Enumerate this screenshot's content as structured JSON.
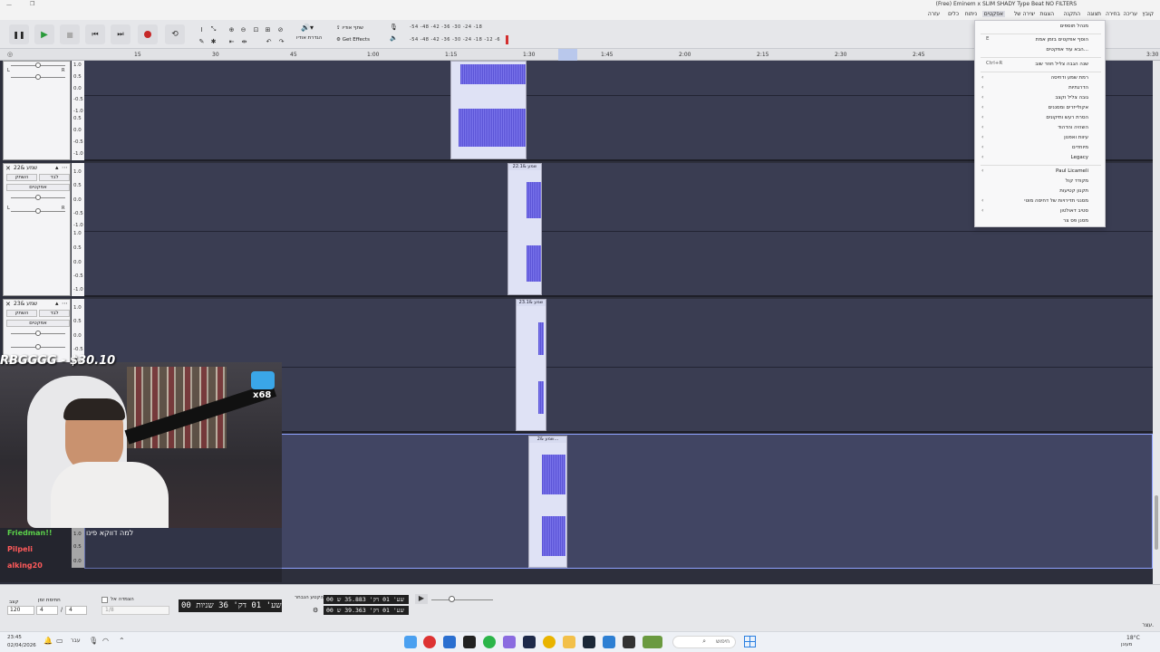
{
  "window": {
    "title": "(Free) Eminem x SLIM SHADY Type Beat  NO FILTERS"
  },
  "menu": [
    "קובץ",
    "עריכה",
    "בחירה",
    "תצוגה",
    "התקנה",
    "הצגות",
    "יצירה של",
    "אפקטים",
    "ניתוח",
    "כלים",
    "עזרה"
  ],
  "toolbar": {
    "share_audio": "שתף אודיו",
    "get_effects": "Get Effects",
    "audio_setup": "הגדרת אודיו",
    "meter_scale": [
      "-54",
      "-48",
      "-42",
      "-36",
      "-30",
      "-24",
      "-18",
      "-12",
      "-6"
    ]
  },
  "ruler": {
    "ticks": [
      "15",
      "30",
      "45",
      "1:00",
      "1:15",
      "1:30",
      "1:45",
      "2:00",
      "2:15",
      "2:30",
      "2:45",
      "3:30"
    ]
  },
  "tracks": [
    {
      "name": "",
      "btn_mute": "השתק",
      "btn_solo": "לבד",
      "effects": "אפקטים",
      "scale": [
        "1.0",
        "0.5",
        "0.0",
        "-0.5",
        "-1.0",
        "0.5",
        "0.0",
        "-0.5",
        "-1.0"
      ],
      "clip_label": ""
    },
    {
      "name": "שמע &22",
      "btn_mute": "השתק",
      "btn_solo": "לבד",
      "effects": "אפקטים",
      "scale": [
        "1.0",
        "0.5",
        "0.0",
        "-0.5",
        "-1.0",
        "1.0",
        "0.5",
        "0.0",
        "-0.5",
        "-1.0"
      ],
      "clip_label": "שמע &22.1"
    },
    {
      "name": "שמע &23",
      "btn_mute": "השתק",
      "btn_solo": "לבד",
      "effects": "אפקטים",
      "scale": [
        "1.0",
        "0.5",
        "0.0",
        "-0.5",
        "-1.0"
      ],
      "clip_label": "שמע &23.1"
    },
    {
      "name": "",
      "btn_mute": "",
      "btn_solo": "",
      "effects": "",
      "scale": [
        "1.0",
        "0.5",
        "0.0",
        "-0.5",
        "-1.0"
      ],
      "clip_label": "שמע &2..."
    }
  ],
  "context_menu": {
    "items": [
      {
        "label": "מנהל תוספים",
        "shortcut": "",
        "submenu": false
      },
      {
        "label": "הוסף אפקטים בזמן אמת",
        "shortcut": "E",
        "submenu": false
      },
      {
        "label": "הבא עוד אפקטים...",
        "shortcut": "",
        "submenu": false
      },
      {
        "label": "שנה הגבה צליל חוזר שוב",
        "shortcut": "Ctrl+R",
        "submenu": false
      },
      {
        "label": "רמת שמע ודחיסה",
        "shortcut": "",
        "submenu": true
      },
      {
        "label": "הדרגתיות",
        "shortcut": "",
        "submenu": true
      },
      {
        "label": "גובה צליל וקצב",
        "shortcut": "",
        "submenu": true
      },
      {
        "label": "אקולייזרים ומסננים",
        "shortcut": "",
        "submenu": true
      },
      {
        "label": "הסרת רעש ותיקונים",
        "shortcut": "",
        "submenu": true
      },
      {
        "label": "השהיה והדהוד",
        "shortcut": "",
        "submenu": true
      },
      {
        "label": "עיוות ואפנון",
        "shortcut": "",
        "submenu": true
      },
      {
        "label": "מיוחדים",
        "shortcut": "",
        "submenu": true
      },
      {
        "label": "Legacy",
        "shortcut": "",
        "submenu": true
      },
      {
        "label": "Paul Licameli",
        "shortcut": "",
        "submenu": true
      },
      {
        "label": "מקודד קול",
        "shortcut": "",
        "submenu": false
      },
      {
        "label": "תקנון קטיעות",
        "shortcut": "",
        "submenu": false
      },
      {
        "label": "מסנני תדירויות של דחיסה מוטי",
        "shortcut": "",
        "submenu": true
      },
      {
        "label": "סטיב דאולטון",
        "shortcut": "",
        "submenu": true
      },
      {
        "label": "מסנן פס צר",
        "shortcut": "",
        "submenu": false
      }
    ]
  },
  "stream": {
    "overlay": "RBGGGG - $30.10",
    "badge": "x68",
    "chat": [
      {
        "user": "Friedman!!",
        "text": "למה דווקא פינו"
      },
      {
        "user": "Pilpeli",
        "text": ""
      },
      {
        "user": "alking20",
        "text": ""
      }
    ]
  },
  "bottom": {
    "tempo_label": "קצב",
    "tempo_value": "120",
    "timesig_label": "חתימת זמן",
    "timesig_num": "4",
    "timesig_den": "4",
    "snap_label": "הצמדה אל",
    "snap_value": "1/8",
    "main_time": "00 שע' 01 דק' 36 שניות",
    "sel_label": "הקטע הנבחר",
    "sel_start": "00 שע' 01 דק' 35.883 ש",
    "sel_end": "00 שע' 01 דק' 39.363 ש"
  },
  "status": {
    "left": "עצר.",
    "right_time": "23:45",
    "right_date": "02/04/2026"
  },
  "taskbar": {
    "search": "חיפוש",
    "weather": "18°C",
    "weather_desc": "מעונן",
    "lang": "עבר"
  }
}
